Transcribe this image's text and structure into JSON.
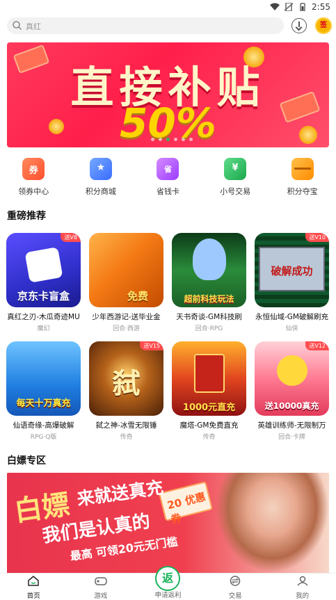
{
  "status_bar": {
    "time": "2:55"
  },
  "search": {
    "placeholder": "真红"
  },
  "avatar": {
    "label": "签"
  },
  "banner": {
    "headline": "直接补贴",
    "percent": "50%",
    "dots": 6,
    "active_dot": 3
  },
  "quick_actions": [
    {
      "label": "领券中心",
      "icon": "coupon-icon",
      "color": "#ff6a3d"
    },
    {
      "label": "积分商城",
      "icon": "shop-icon",
      "color": "#4a8cff"
    },
    {
      "label": "省钱卡",
      "icon": "card-icon",
      "color": "#b45cff"
    },
    {
      "label": "小号交易",
      "icon": "trade-icon",
      "color": "#27c15c"
    },
    {
      "label": "积分夺宝",
      "icon": "treasure-icon",
      "color": "#ff9b1a"
    }
  ],
  "sections": {
    "recommend": "重磅推荐",
    "free": "白嫖专区"
  },
  "games": [
    {
      "name": "真红之刃-木瓜奇迹MU",
      "tag": "魔幻",
      "badge": "送V8",
      "img_text": "京东卡盲盒",
      "bg": "#3a39d6"
    },
    {
      "name": "少年西游记-送毕业金",
      "tag": "回合·西游",
      "badge": "",
      "img_text": "免费",
      "bg": "#f47a15"
    },
    {
      "name": "天书奇谈-GM科技刷",
      "tag": "回合·RPG",
      "badge": "",
      "img_text": "超前科技玩法",
      "bg": "#2a8c3a"
    },
    {
      "name": "永恒仙域-GM破解刷充",
      "tag": "仙侠",
      "badge": "送V10",
      "img_text": "破解成功",
      "bg": "#0f5a2e"
    },
    {
      "name": "仙语奇缘-高爆破解",
      "tag": "RPG·Q版",
      "badge": "",
      "img_text": "每天十万真充",
      "bg": "#1f7ee0"
    },
    {
      "name": "弑之神-冰雪无限锤",
      "tag": "传奇",
      "badge": "送V15",
      "img_text": "弑",
      "bg": "#6b3412"
    },
    {
      "name": "魔塔-GM免费直充",
      "tag": "传奇",
      "badge": "",
      "img_text": "1000元直充",
      "bg": "#c5241a"
    },
    {
      "name": "英雄训练师-无限制万",
      "tag": "回合·卡牌",
      "badge": "送V12",
      "img_text": "送10000真充",
      "bg": "#e23b5a"
    }
  ],
  "promo": {
    "line1": "白嫖",
    "line2": "来就送真充",
    "line3": "我们是认真的",
    "line4": "最高 可领20元无门槛",
    "coupon": "20 优惠券"
  },
  "tabs": [
    {
      "label": "首页",
      "active": true
    },
    {
      "label": "游戏",
      "active": false
    },
    {
      "label": "申请返利",
      "active": false,
      "fab": "返"
    },
    {
      "label": "交易",
      "active": false
    },
    {
      "label": "我的",
      "active": false
    }
  ]
}
